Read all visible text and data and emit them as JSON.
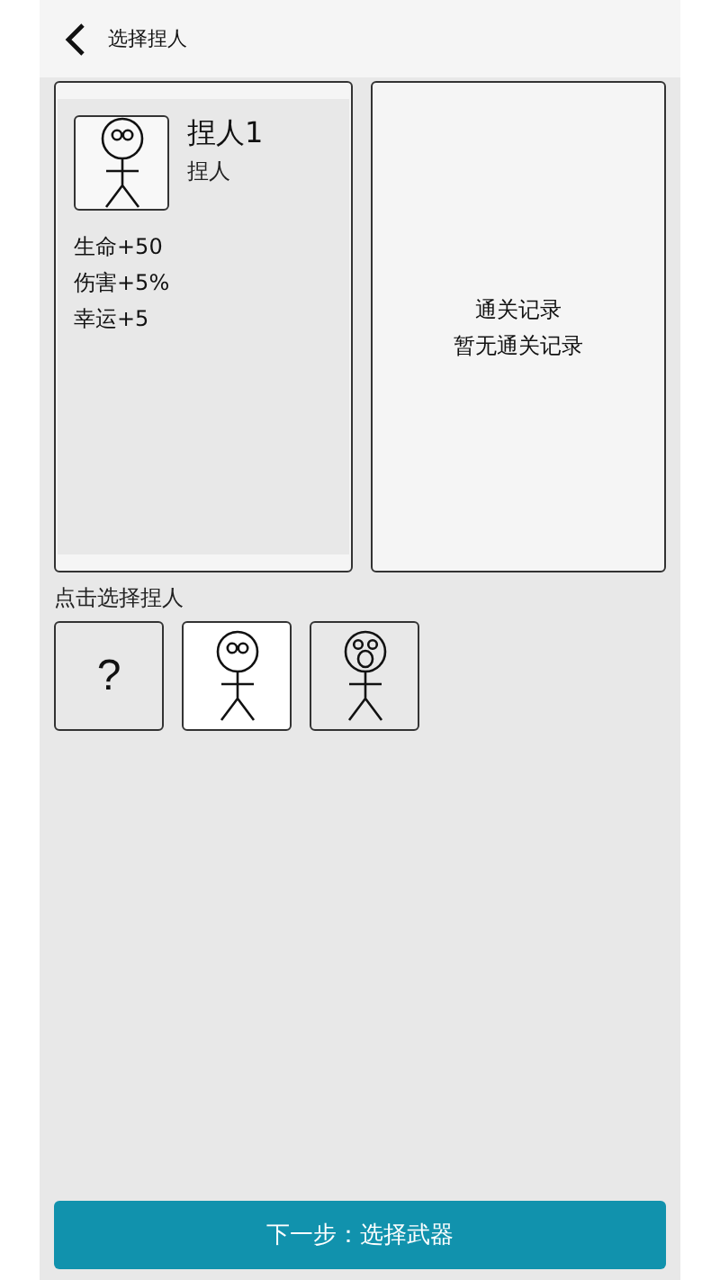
{
  "header": {
    "title": "选择捏人"
  },
  "character": {
    "name": "捏人1",
    "type": "捏人",
    "kind": "stick",
    "stats": [
      "生命+50",
      "伤害+5%",
      "幸运+5"
    ]
  },
  "records": {
    "title": "通关记录",
    "empty_text": "暂无通关记录"
  },
  "picker": {
    "label": "点击选择捏人",
    "options": [
      {
        "kind": "unknown",
        "symbol": "?",
        "selected": false
      },
      {
        "kind": "stick",
        "selected": true
      },
      {
        "kind": "surprised_stick",
        "selected": false
      }
    ]
  },
  "next_button": {
    "label": "下一步：选择武器"
  }
}
